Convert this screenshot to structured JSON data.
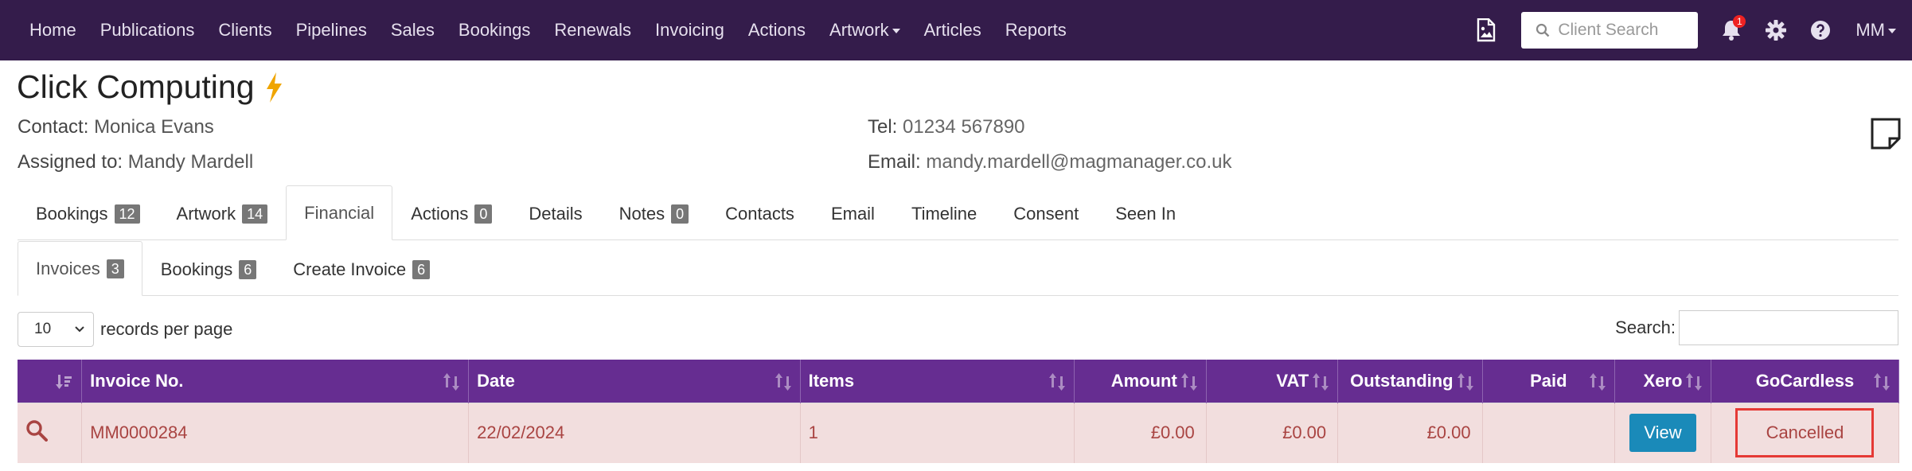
{
  "nav": {
    "links": [
      "Home",
      "Publications",
      "Clients",
      "Pipelines",
      "Sales",
      "Bookings",
      "Renewals",
      "Invoicing",
      "Actions"
    ],
    "artwork": "Artwork",
    "articles": "Articles",
    "reports": "Reports",
    "search_placeholder": "Client Search",
    "notification_count": "1",
    "user": "MM"
  },
  "client": {
    "name": "Click Computing",
    "contact_label": "Contact:",
    "contact_value": "Monica Evans",
    "assigned_label": "Assigned to:",
    "assigned_value": "Mandy Mardell",
    "tel_label": "Tel:",
    "tel_value": "01234 567890",
    "email_label": "Email:",
    "email_value": "mandy.mardell@magmanager.co.uk"
  },
  "tabs": [
    {
      "label": "Bookings",
      "badge": "12"
    },
    {
      "label": "Artwork",
      "badge": "14"
    },
    {
      "label": "Financial",
      "badge": ""
    },
    {
      "label": "Actions",
      "badge": "0"
    },
    {
      "label": "Details",
      "badge": ""
    },
    {
      "label": "Notes",
      "badge": "0"
    },
    {
      "label": "Contacts",
      "badge": ""
    },
    {
      "label": "Email",
      "badge": ""
    },
    {
      "label": "Timeline",
      "badge": ""
    },
    {
      "label": "Consent",
      "badge": ""
    },
    {
      "label": "Seen In",
      "badge": ""
    }
  ],
  "subtabs": [
    {
      "label": "Invoices",
      "badge": "3"
    },
    {
      "label": "Bookings",
      "badge": "6"
    },
    {
      "label": "Create Invoice",
      "badge": "6"
    }
  ],
  "table_controls": {
    "rpp_value": "10",
    "rpp_label": "records per page",
    "search_label": "Search:"
  },
  "table": {
    "headers": [
      "Invoice No.",
      "Date",
      "Items",
      "Amount",
      "VAT",
      "Outstanding",
      "Paid",
      "Xero",
      "GoCardless"
    ],
    "row": {
      "invoice_no": "MM0000284",
      "date": "22/02/2024",
      "items": "1",
      "amount": "£0.00",
      "vat": "£0.00",
      "outstanding": "£0.00",
      "paid": "",
      "xero_button": "View",
      "gocardless": "Cancelled"
    }
  },
  "colors": {
    "navbar": "#341c4b",
    "table_header": "#662d91",
    "row_danger": "#f2dede",
    "view_button": "#1a8ab9",
    "highlight": "#e53935"
  }
}
